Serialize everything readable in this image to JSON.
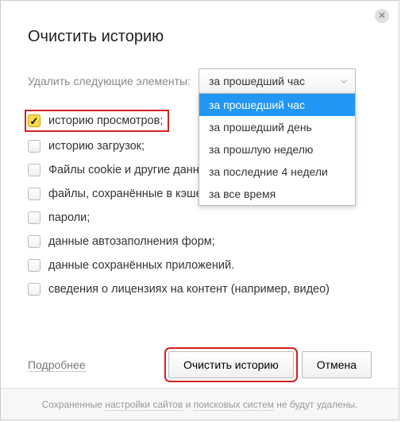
{
  "dialog": {
    "title": "Очистить историю",
    "time_label": "Удалить следующие элементы:",
    "select": {
      "value": "за прошедший час",
      "options": [
        "за прошедший час",
        "за прошедший день",
        "за прошлую неделю",
        "за последние 4 недели",
        "за все время"
      ]
    },
    "checks": [
      {
        "label": "историю просмотров;",
        "checked": true,
        "highlight": true
      },
      {
        "label": "историю загрузок;",
        "checked": false,
        "highlight": false
      },
      {
        "label": "Файлы cookie и другие данные сайтов и модулей",
        "checked": false,
        "highlight": false
      },
      {
        "label": "файлы, сохранённые в кэше;",
        "checked": false,
        "highlight": false
      },
      {
        "label": "пароли;",
        "checked": false,
        "highlight": false
      },
      {
        "label": "данные автозаполнения форм;",
        "checked": false,
        "highlight": false
      },
      {
        "label": "данные сохранённых приложений.",
        "checked": false,
        "highlight": false
      },
      {
        "label": "сведения о лицензиях на контент (например, видео)",
        "checked": false,
        "highlight": false
      }
    ],
    "more_link": "Подробнее",
    "buttons": {
      "clear": "Очистить историю",
      "cancel": "Отмена"
    },
    "bottom_note": {
      "prefix": "Сохраненные ",
      "link1": "настройки сайтов",
      "mid": " и ",
      "link2": "поисковых систем",
      "suffix": " не будут удалены."
    }
  }
}
